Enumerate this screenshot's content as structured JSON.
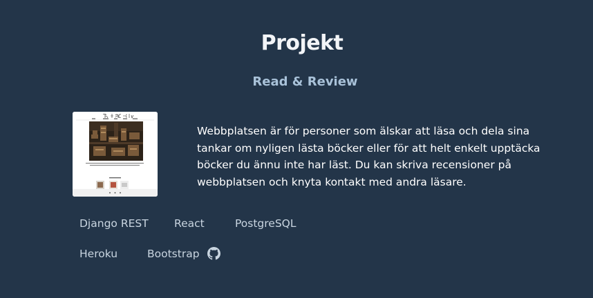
{
  "section": {
    "title": "Projekt"
  },
  "project": {
    "title": "Read & Review",
    "description": "Webbplatsen är för personer som älskar att läsa och dela sina tankar om nyligen lästa böcker eller för att helt enkelt upptäcka böcker du ännu inte har läst. Du kan skriva recensioner på webbplatsen och knyta kontakt med andra läsare.",
    "screenshot_logo_text": "Read & Review",
    "technologies": [
      "Django REST",
      "React",
      "PostgreSQL",
      "Heroku",
      "Bootstrap"
    ],
    "github_icon": "github-icon"
  },
  "colors": {
    "background": "#233549",
    "heading": "#f2f4f7",
    "subheading": "#a9c2d9",
    "tag": "#c9d5e0"
  }
}
